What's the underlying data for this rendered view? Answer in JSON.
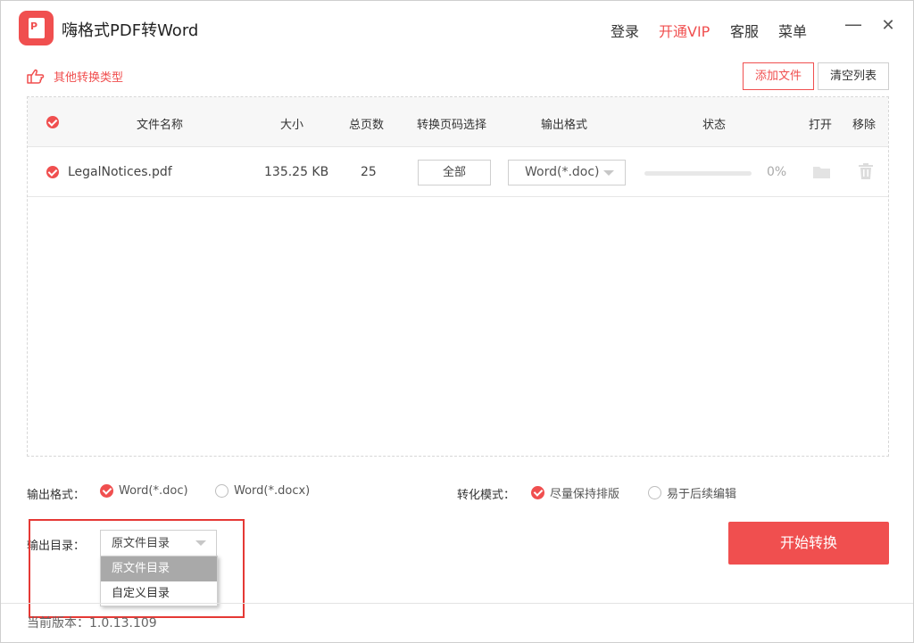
{
  "app": {
    "title": "嗨格式PDF转Word",
    "nav": {
      "login": "登录",
      "vip": "开通VIP",
      "service": "客服",
      "menu": "菜单"
    },
    "window": {
      "minimize": "—",
      "close": "✕"
    }
  },
  "toolbar": {
    "other_types": "其他转换类型",
    "add_file": "添加文件",
    "clear_list": "清空列表"
  },
  "table": {
    "headers": {
      "name": "文件名称",
      "size": "大小",
      "pages": "总页数",
      "range": "转换页码选择",
      "format": "输出格式",
      "status": "状态",
      "open": "打开",
      "remove": "移除"
    },
    "rows": [
      {
        "name": "LegalNotices.pdf",
        "size": "135.25 KB",
        "pages": "25",
        "range": "全部",
        "format": "Word(*.doc)",
        "progress": 0,
        "percent": "0%"
      }
    ]
  },
  "options": {
    "output_format_label": "输出格式：",
    "format_doc": "Word(*.doc)",
    "format_docx": "Word(*.docx)",
    "mode_label": "转化模式：",
    "mode_keep_layout": "尽量保持排版",
    "mode_easy_edit": "易于后续编辑",
    "output_dir_label": "输出目录：",
    "output_dir_value": "原文件目录",
    "output_dir_options": [
      "原文件目录",
      "自定义目录"
    ]
  },
  "actions": {
    "start": "开始转换"
  },
  "footer": {
    "version": "当前版本：1.0.13.109"
  },
  "colors": {
    "accent": "#f04f4f",
    "highlight": "#e53935"
  }
}
